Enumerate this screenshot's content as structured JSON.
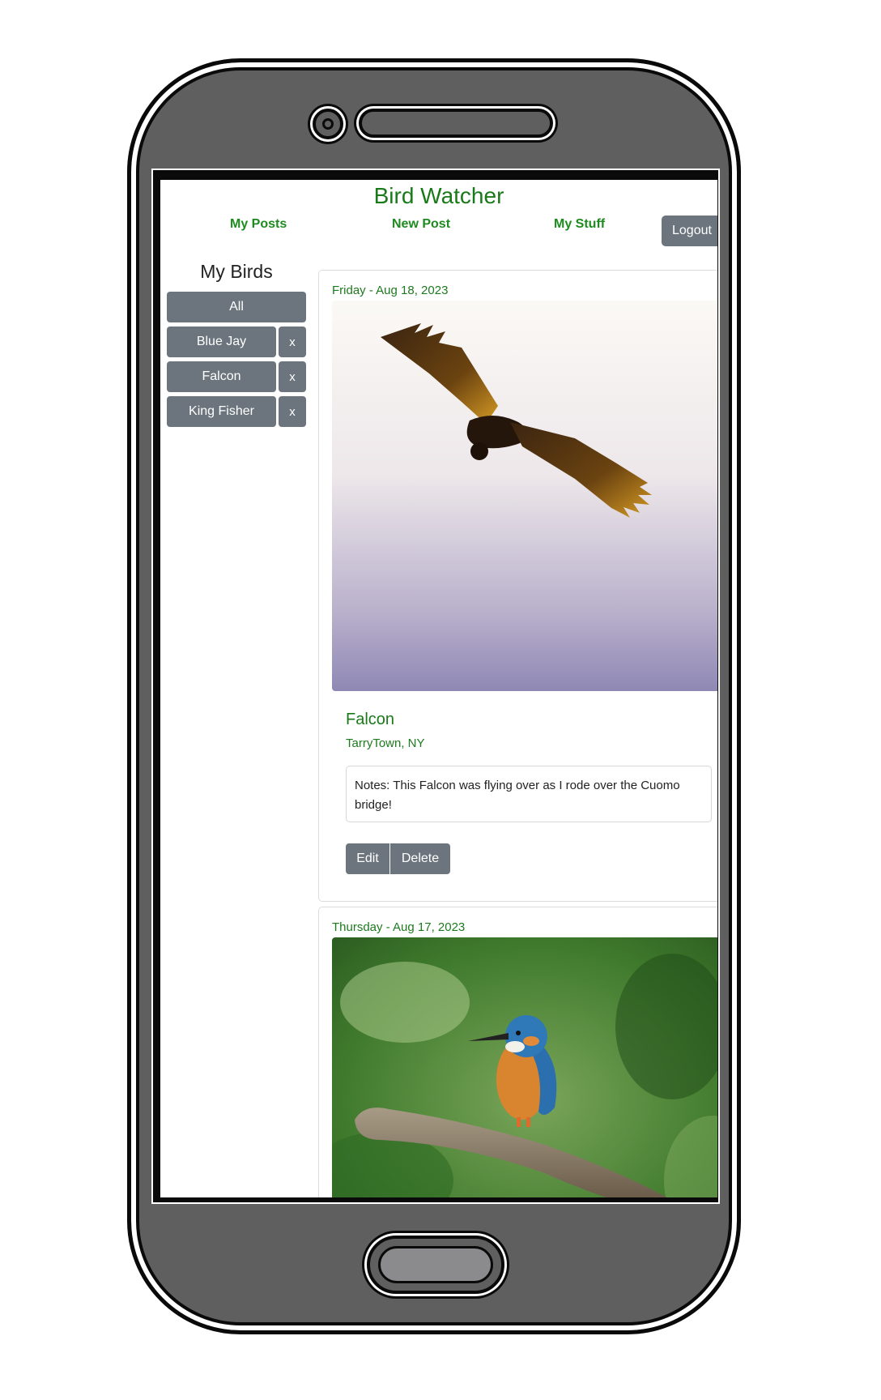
{
  "app": {
    "title": "Bird Watcher"
  },
  "nav": {
    "my_posts": "My Posts",
    "new_post": "New Post",
    "my_stuff": "My Stuff",
    "logout": "Logout"
  },
  "sidebar": {
    "title": "My Birds",
    "all_label": "All",
    "birds": [
      {
        "label": "Blue Jay",
        "delete_label": "x"
      },
      {
        "label": "Falcon",
        "delete_label": "x"
      },
      {
        "label": "King Fisher",
        "delete_label": "x"
      }
    ]
  },
  "posts": [
    {
      "date": "Friday - Aug 18, 2023",
      "bird": "Falcon",
      "location": "TarryTown, NY",
      "notes": "Notes: This Falcon was flying over as I rode over the Cuomo bridge!",
      "edit_label": "Edit",
      "delete_label": "Delete",
      "image": "falcon-in-flight-photo"
    },
    {
      "date": "Thursday - Aug 17, 2023",
      "image": "kingfisher-on-branch-photo"
    }
  ],
  "colors": {
    "accent_green": "#1a7a1a",
    "button_gray": "#6c757d",
    "phone_body": "#5f5f5f"
  }
}
